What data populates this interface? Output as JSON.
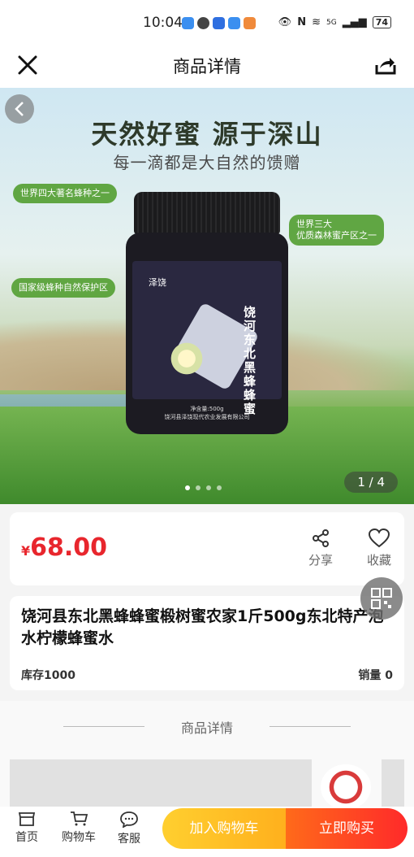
{
  "status": {
    "time": "10:04",
    "network": "5G",
    "battery": "74"
  },
  "nav": {
    "title": "商品详情"
  },
  "banner": {
    "headline": "天然好蜜 源于深山",
    "subline": "每一滴都是大自然的馈赠",
    "tags": [
      "世界四大著名蜂种之一",
      "世界三大\n优质森林蜜产区之一",
      "国家级蜂种自然保护区"
    ],
    "jar_brand": "泽饶",
    "jar_name": "饶河东北黑蜂蜂蜜",
    "jar_weight": "净含量:500g",
    "jar_company": "饶河县泽饶现代农业发展有限公司",
    "counter": "1 / 4",
    "slide_index": 1,
    "slide_total": 4
  },
  "price": {
    "currency": "¥",
    "amount": "68.00",
    "share_label": "分享",
    "fav_label": "收藏"
  },
  "product": {
    "title": "饶河县东北黑蜂蜂蜜椴树蜜农家1斤500g东北特产泡水柠檬蜂蜜水",
    "stock": "库存1000",
    "sales": "销量 0"
  },
  "details": {
    "section_title": "商品详情"
  },
  "bottom": {
    "home": "首页",
    "cart": "购物车",
    "service": "客服",
    "add_cart": "加入购物车",
    "buy_now": "立即购买"
  },
  "colors": {
    "price": "#e8262d",
    "cart_button": "#ffb01d",
    "buy_button": "#ff2a2a"
  }
}
